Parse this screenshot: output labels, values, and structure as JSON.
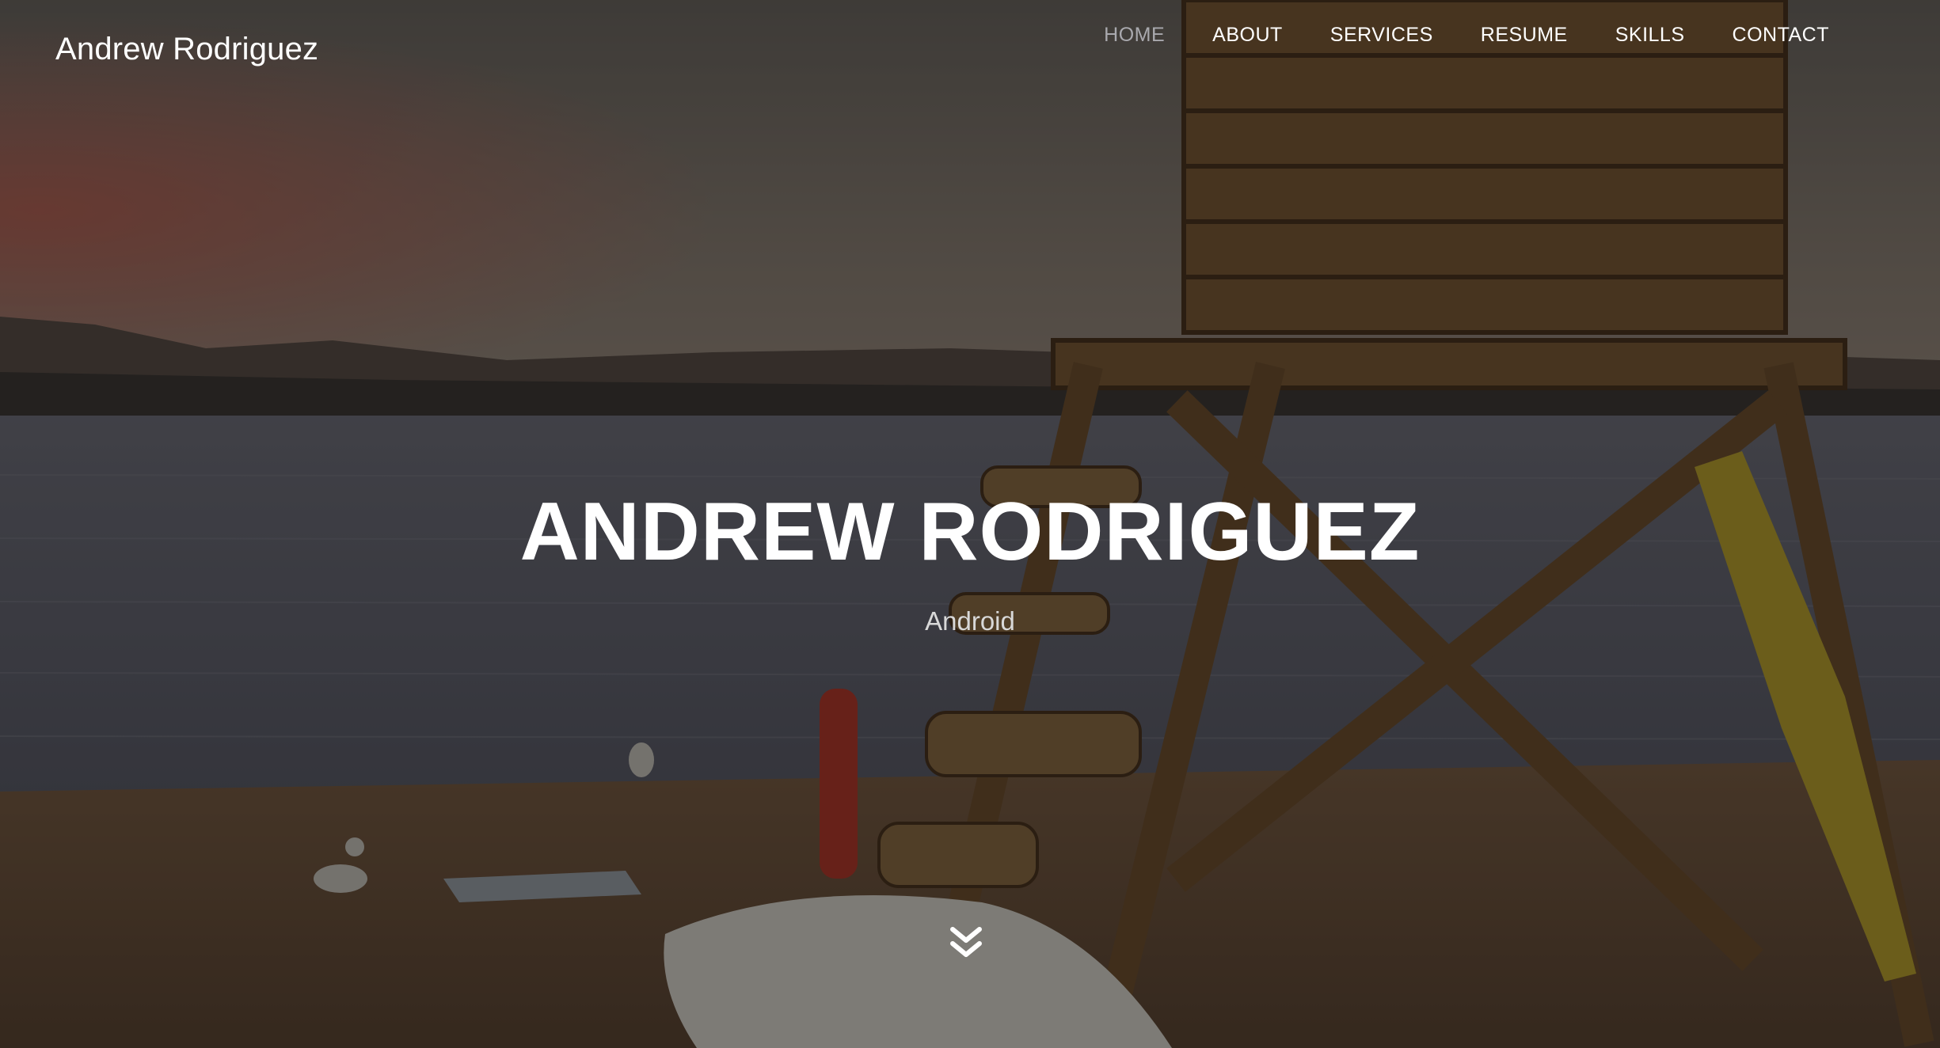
{
  "brand": {
    "name": "Andrew Rodriguez"
  },
  "nav": {
    "items": [
      {
        "label": "HOME",
        "active": true
      },
      {
        "label": "ABOUT",
        "active": false
      },
      {
        "label": "SERVICES",
        "active": false
      },
      {
        "label": "RESUME",
        "active": false
      },
      {
        "label": "SKILLS",
        "active": false
      },
      {
        "label": "CONTACT",
        "active": false
      }
    ],
    "active_color": "#a9a9ae",
    "text_color": "#ffffff"
  },
  "hero": {
    "title": "ANDREW RODRIGUEZ",
    "subtitle": "Android",
    "scroll_icon": "double-chevron-down-icon",
    "overlay_color": "#000000"
  }
}
